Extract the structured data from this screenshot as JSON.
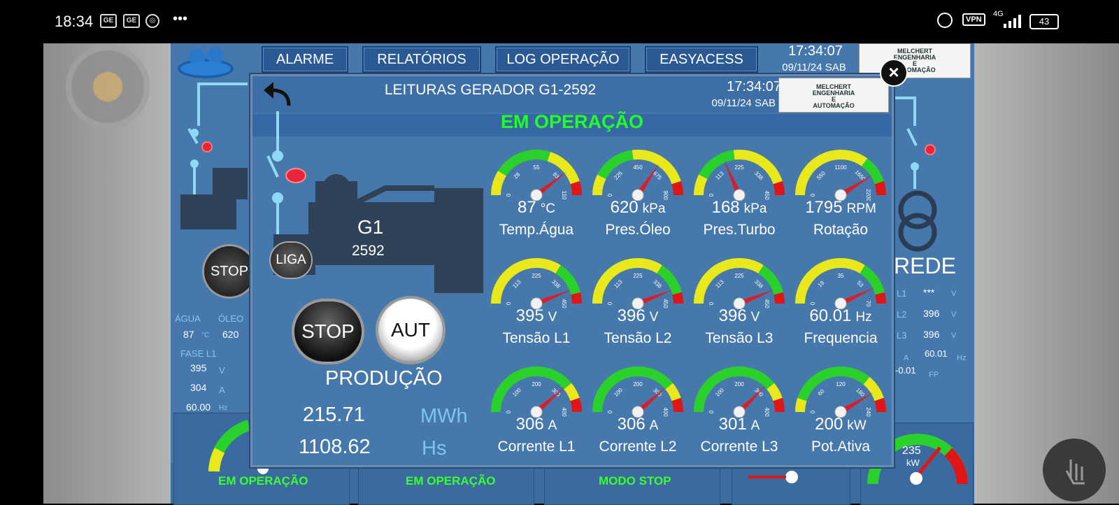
{
  "status_bar": {
    "time": "18:34",
    "vpn": "VPN",
    "network": "4G",
    "battery": "43",
    "more": "•••"
  },
  "scada": {
    "top_buttons": [
      "ALARME",
      "RELATÓRIOS",
      "LOG OPERAÇÃO",
      "EASYACESS"
    ],
    "time": "17:34:07",
    "date": "09/11/24 SAB",
    "logo_lines": [
      "MELCHERT",
      "ENGENHARIA",
      "E",
      "AUTOMAÇÃO"
    ],
    "left_stop": "STOP",
    "left_labels": {
      "agua": "ÁGUA",
      "oleo": "ÓLEO",
      "agua_val": "87",
      "agua_unit": "°C",
      "oleo_val": "620",
      "fase": "FASE L1",
      "fase_v": "395",
      "v_unit": "V",
      "fase_a": "304",
      "a_unit": "A",
      "fase_hz": "60.00",
      "hz_unit": "Hz"
    },
    "rede": {
      "title": "REDE",
      "rows": [
        {
          "label": "L1",
          "value": "***",
          "unit": "V"
        },
        {
          "label": "L2",
          "value": "396",
          "unit": "V"
        },
        {
          "label": "L3",
          "value": "396",
          "unit": "V"
        }
      ],
      "hz_label": "A",
      "hz_value": "60.01",
      "hz_unit": "Hz",
      "fp_value": "-0.01",
      "fp_unit": "FP"
    },
    "bottom_labels": [
      "EM OPERAÇÃO",
      "EM OPERAÇÃO",
      "MODO STOP"
    ],
    "bottom_gauge": {
      "value": "235",
      "unit": "kW"
    },
    "kw_small": "kW"
  },
  "dialog": {
    "title": "LEITURAS GERADOR G1-2592",
    "time": "17:34:07",
    "date": "09/11/24 SAB",
    "status": "EM OPERAÇÃO",
    "generator_name": "G1",
    "generator_id": "2592",
    "liga_label": "LIGA",
    "stop_label": "STOP",
    "aut_label": "AUT",
    "production_title": "PRODUÇÃO",
    "production": [
      {
        "value": "215.71",
        "unit": "MWh"
      },
      {
        "value": "1108.62",
        "unit": "Hs"
      }
    ]
  },
  "gauges": [
    {
      "value": "87",
      "unit": "°C",
      "label": "Temp.Água",
      "ticks": [
        "0",
        "28",
        "55",
        "83",
        "110"
      ],
      "fraction": 0.79,
      "scheme": "temp"
    },
    {
      "value": "620",
      "unit": "kPa",
      "label": "Pres.Óleo",
      "ticks": [
        "0",
        "225",
        "450",
        "675",
        "900"
      ],
      "fraction": 0.69,
      "scheme": "press"
    },
    {
      "value": "168",
      "unit": "kPa",
      "label": "Pres.Turbo",
      "ticks": [
        "0",
        "113",
        "225",
        "338",
        "450"
      ],
      "fraction": 0.37,
      "scheme": "press"
    },
    {
      "value": "1795",
      "unit": "RPM",
      "label": "Rotação",
      "ticks": [
        "0",
        "550",
        "1100",
        "1650",
        "2200"
      ],
      "fraction": 0.82,
      "scheme": "rpm"
    },
    {
      "value": "395",
      "unit": "V",
      "label": "Tensão L1",
      "ticks": [
        "0",
        "113",
        "225",
        "338",
        "450"
      ],
      "fraction": 0.88,
      "scheme": "volt"
    },
    {
      "value": "396",
      "unit": "V",
      "label": "Tensão L2",
      "ticks": [
        "0",
        "113",
        "225",
        "338",
        "450"
      ],
      "fraction": 0.88,
      "scheme": "volt"
    },
    {
      "value": "396",
      "unit": "V",
      "label": "Tensão L3",
      "ticks": [
        "0",
        "113",
        "225",
        "338",
        "450"
      ],
      "fraction": 0.88,
      "scheme": "volt"
    },
    {
      "value": "60.01",
      "unit": "Hz",
      "label": "Frequencia",
      "ticks": [
        "0",
        "18",
        "35",
        "53",
        "70"
      ],
      "fraction": 0.86,
      "scheme": "volt"
    },
    {
      "value": "306",
      "unit": "A",
      "label": "Corrente L1",
      "ticks": [
        "0",
        "100",
        "200",
        "300",
        "400"
      ],
      "fraction": 0.77,
      "scheme": "curr"
    },
    {
      "value": "306",
      "unit": "A",
      "label": "Corrente L2",
      "ticks": [
        "0",
        "100",
        "200",
        "300",
        "400"
      ],
      "fraction": 0.77,
      "scheme": "curr"
    },
    {
      "value": "301",
      "unit": "A",
      "label": "Corrente L3",
      "ticks": [
        "0",
        "100",
        "200",
        "300",
        "400"
      ],
      "fraction": 0.75,
      "scheme": "curr"
    },
    {
      "value": "200",
      "unit": "kW",
      "label": "Pot.Ativa",
      "ticks": [
        "0",
        "60",
        "120",
        "180",
        "240"
      ],
      "fraction": 0.83,
      "scheme": "pot"
    }
  ],
  "colors": {
    "green": "#2bd12b",
    "yellow": "#e8e81a",
    "red": "#e01515",
    "status_green": "#22ff22",
    "panel": "#4678ab"
  }
}
